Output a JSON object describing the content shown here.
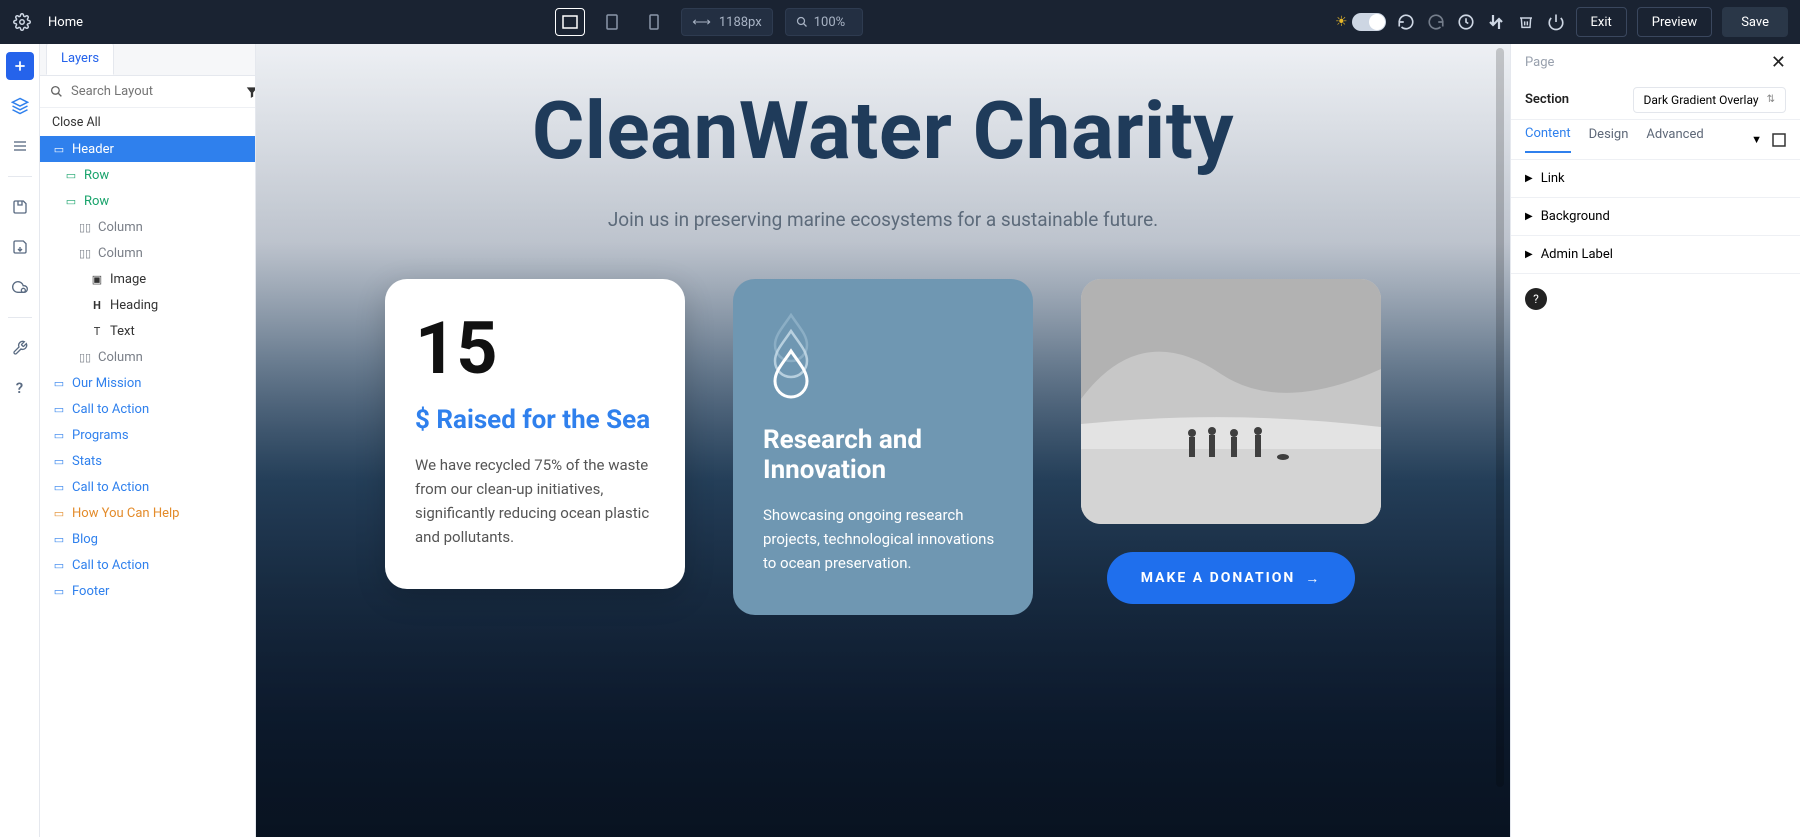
{
  "topbar": {
    "home": "Home",
    "dim_value": "1188px",
    "zoom_value": "100%",
    "exit": "Exit",
    "preview": "Preview",
    "save": "Save"
  },
  "layers_panel": {
    "tab": "Layers",
    "search_placeholder": "Search Layout",
    "close_all": "Close All",
    "tree": {
      "header": "Header",
      "row1": "Row",
      "row2": "Row",
      "col1": "Column",
      "col2": "Column",
      "image": "Image",
      "heading": "Heading",
      "text": "Text",
      "col3": "Column",
      "mission": "Our Mission",
      "cta1": "Call to Action",
      "programs": "Programs",
      "stats": "Stats",
      "cta2": "Call to Action",
      "howhelp": "How You Can Help",
      "blog": "Blog",
      "cta3": "Call to Action",
      "footer": "Footer"
    }
  },
  "canvas": {
    "title": "CleanWater Charity",
    "subtitle": "Join us in preserving marine ecosystems for a sustainable future.",
    "card1": {
      "num": "15",
      "title": "$ Raised for the Sea",
      "text": "We have recycled 75% of the waste from our clean-up initiatives, significantly reducing ocean plastic and pollutants."
    },
    "card2": {
      "title": "Research and Innovation",
      "text": "Showcasing ongoing research projects, technological innovations to ocean preservation."
    },
    "cta_button": "MAKE A DONATION"
  },
  "rpanel": {
    "breadcrumb": "Page",
    "section_label": "Section",
    "preset": "Dark Gradient Overlay",
    "tabs": {
      "content": "Content",
      "design": "Design",
      "advanced": "Advanced"
    },
    "groups": {
      "link": "Link",
      "background": "Background",
      "admin": "Admin Label"
    }
  }
}
